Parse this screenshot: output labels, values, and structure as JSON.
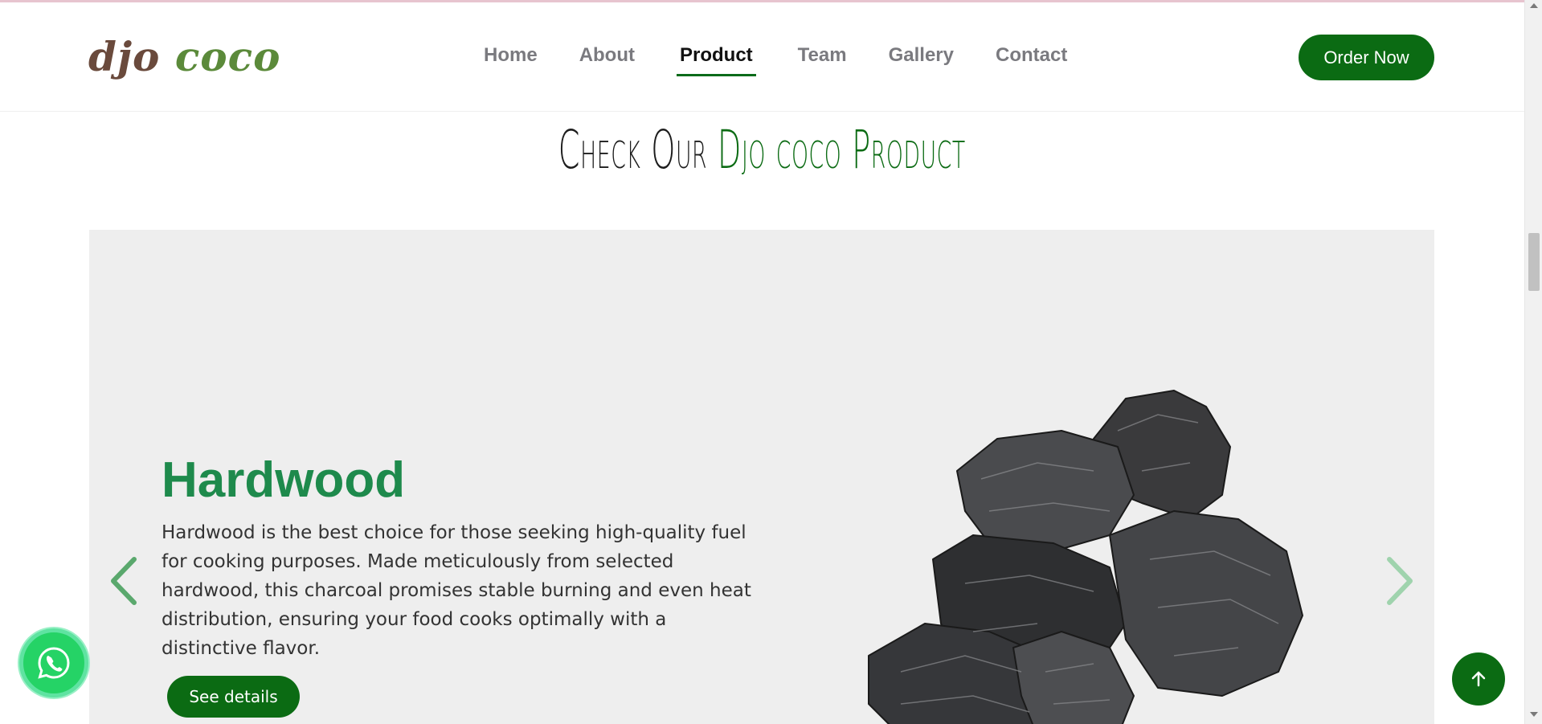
{
  "header": {
    "logo": {
      "part1": "djo",
      "part2": "coco"
    },
    "nav": [
      {
        "label": "Home",
        "active": false
      },
      {
        "label": "About",
        "active": false
      },
      {
        "label": "Product",
        "active": true
      },
      {
        "label": "Team",
        "active": false
      },
      {
        "label": "Gallery",
        "active": false
      },
      {
        "label": "Contact",
        "active": false
      }
    ],
    "order_button": "Order Now"
  },
  "section": {
    "title_part1": "Check Our",
    "title_part2": "Djo coco Product"
  },
  "slide": {
    "title": "Hardwood",
    "description": "Hardwood is the best choice for those seeking high-quality fuel for cooking purposes. Made meticulously from selected hardwood, this charcoal promises stable burning and even heat distribution, ensuring your food cooks optimally with a distinctive flavor.",
    "button": "See details",
    "image_icon": "charcoal-image"
  },
  "controls": {
    "prev_icon": "chevron-left-icon",
    "next_icon": "chevron-right-icon",
    "whatsapp_icon": "whatsapp-icon",
    "scroll_top_icon": "arrow-up-icon"
  },
  "colors": {
    "brand_green": "#0b6b13",
    "title_green": "#1e8a4c",
    "logo_brown": "#6a4a3c",
    "logo_green": "#5b8a3a",
    "slider_bg": "#eeeeee",
    "whatsapp": "#25d366"
  }
}
